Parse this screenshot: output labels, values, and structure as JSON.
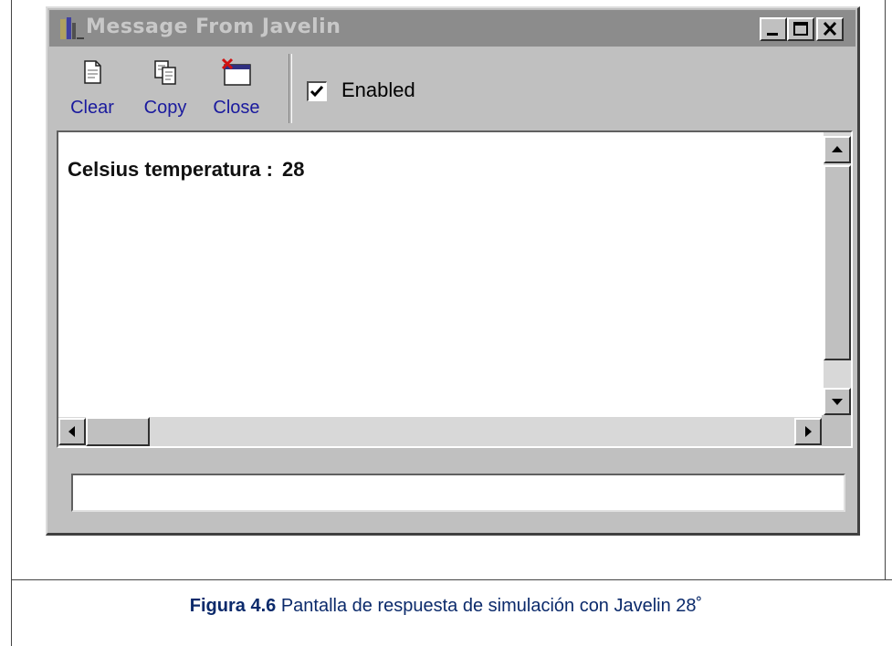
{
  "window": {
    "title": "Message From Javelin",
    "controls": [
      "minimize-icon",
      "maximize-icon",
      "close-icon"
    ]
  },
  "toolbar": {
    "clear_label": "Clear",
    "copy_label": "Copy",
    "close_label": "Close",
    "enabled_label": "Enabled",
    "enabled_checked": true
  },
  "output": {
    "label": "Celsius temperatura :",
    "value": "28"
  },
  "status": {
    "value": ""
  },
  "caption": {
    "figure": "Figura 4.6",
    "text": " Pantalla de respuesta  de simulación con Javelin  28˚"
  },
  "colors": {
    "titlebar": "#8c8c8c",
    "face": "#c0c0c0",
    "label_blue": "#1a1a9e"
  }
}
